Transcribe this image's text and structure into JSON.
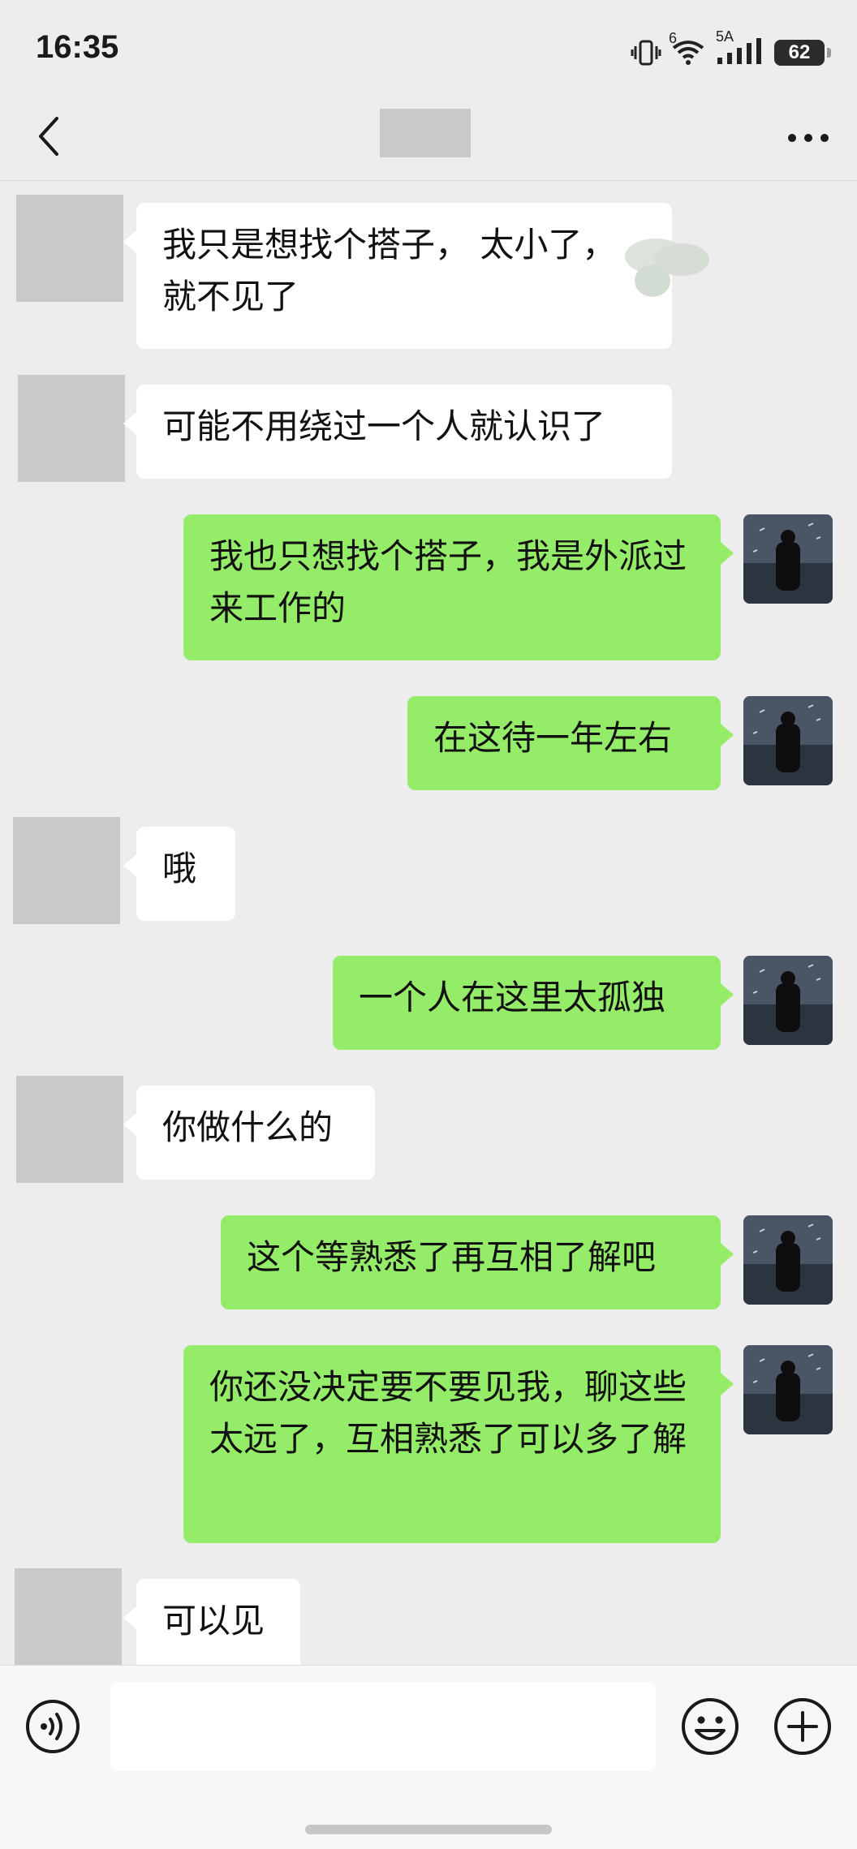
{
  "status_bar": {
    "time": "16:35",
    "network_label": "5A",
    "wifi_label": "6",
    "battery": "62",
    "icons": [
      "vibrate-icon",
      "wifi-icon",
      "signal-icon",
      "battery-icon"
    ]
  },
  "nav": {
    "back_icon": "chevron-left-icon",
    "more_icon": "more-dots-icon"
  },
  "messages": [
    {
      "side": "in",
      "text": "我只是想找个搭子，        太小了，就不见了"
    },
    {
      "side": "in",
      "text": "可能不用绕过一个人就认识了"
    },
    {
      "side": "out",
      "text": "我也只想找个搭子，我是外派过来工作的"
    },
    {
      "side": "out",
      "text": "在这待一年左右"
    },
    {
      "side": "in",
      "text": "哦"
    },
    {
      "side": "out",
      "text": "一个人在这里太孤独"
    },
    {
      "side": "in",
      "text": "你做什么的"
    },
    {
      "side": "out",
      "text": "这个等熟悉了再互相了解吧"
    },
    {
      "side": "out",
      "text": "你还没决定要不要见我，聊这些太远了，互相熟悉了可以多了解"
    },
    {
      "side": "in",
      "text": "可以见"
    }
  ],
  "input_bar": {
    "placeholder": "",
    "voice_icon": "voice-icon",
    "emoji_icon": "emoji-icon",
    "plus_icon": "plus-icon"
  },
  "colors": {
    "background": "#ededed",
    "incoming_bubble": "#ffffff",
    "outgoing_bubble": "#95ec69"
  }
}
